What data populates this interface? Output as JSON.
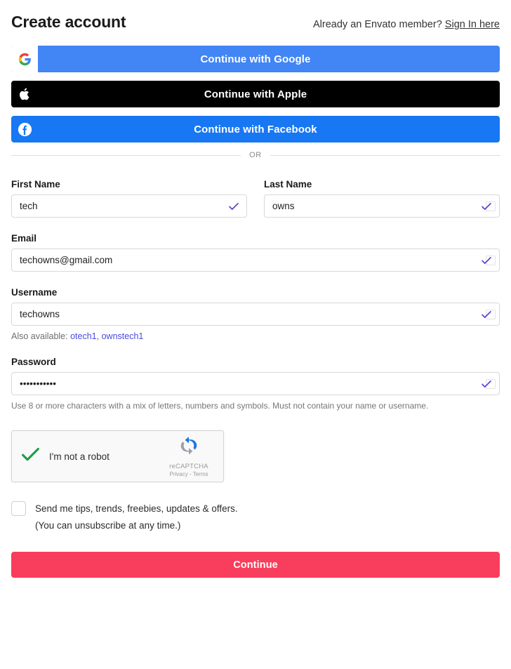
{
  "header": {
    "title": "Create account",
    "member_prompt": "Already an Envato member?",
    "signin_link": "Sign In here"
  },
  "social_buttons": [
    {
      "id": "google",
      "label": "Continue with Google",
      "icon": "google-icon",
      "bg": "#4285f4"
    },
    {
      "id": "apple",
      "label": "Continue with Apple",
      "icon": "apple-icon",
      "bg": "#000000"
    },
    {
      "id": "facebook",
      "label": "Continue with Facebook",
      "icon": "facebook-icon",
      "bg": "#1877f2"
    }
  ],
  "divider": {
    "text": "OR"
  },
  "form": {
    "first_name": {
      "label": "First Name",
      "value": "tech",
      "placeholder": "First Name",
      "valid": true
    },
    "last_name": {
      "label": "Last Name",
      "value": "owns",
      "placeholder": "Last Name",
      "valid": true
    },
    "email": {
      "label": "Email",
      "value": "techowns@gmail.com",
      "placeholder": "Email",
      "valid": true
    },
    "username": {
      "label": "Username",
      "value": "techowns",
      "placeholder": "Username",
      "valid": true,
      "suggestion_prefix": "Also available:",
      "suggestions": [
        "otech1",
        "ownstech1"
      ],
      "suggestion_separator": ","
    },
    "password": {
      "label": "Password",
      "value": "•••••••••••",
      "placeholder": "Password",
      "valid": true,
      "helper": "Use 8 or more characters with a mix of letters, numbers and symbols. Must not contain your name or username."
    }
  },
  "recaptcha": {
    "checkbox_label": "I'm not a robot",
    "checked": true,
    "brand_name": "reCAPTCHA",
    "legal": "Privacy - Terms"
  },
  "optin": {
    "checked": false,
    "line1": "Send me tips, trends, freebies, updates & offers.",
    "line2": "(You can unsubscribe at any time.)"
  },
  "submit": {
    "label": "Continue",
    "color": "#f93d5c"
  },
  "colors": {
    "check_purple": "#5b3fd8",
    "link_purple": "#4a4ae0",
    "green_check": "#1e9e4a"
  }
}
